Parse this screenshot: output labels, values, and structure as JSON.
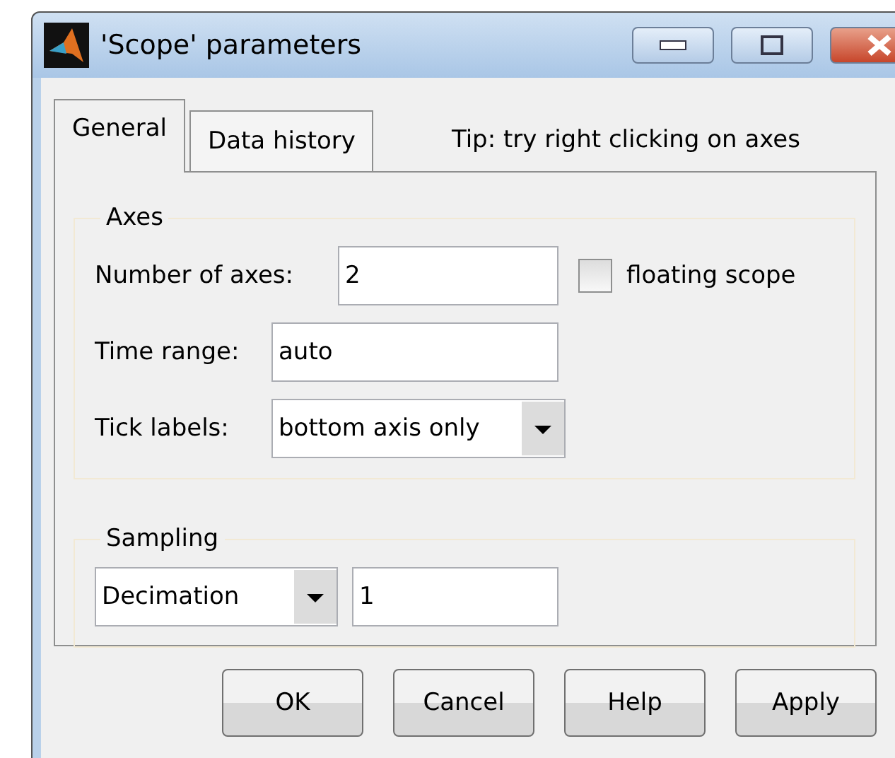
{
  "window": {
    "title": "'Scope' parameters"
  },
  "tabs": [
    {
      "label": "General",
      "selected": true
    },
    {
      "label": "Data history",
      "selected": false
    }
  ],
  "tip": "Tip: try right clicking on axes",
  "axes": {
    "legend": "Axes",
    "number_of_axes": {
      "label": "Number of axes:",
      "value": "2"
    },
    "floating_scope": {
      "label": "floating scope",
      "checked": false
    },
    "time_range": {
      "label": "Time range:",
      "value": "auto"
    },
    "tick_labels": {
      "label": "Tick labels:",
      "value": "bottom axis only"
    }
  },
  "sampling": {
    "legend": "Sampling",
    "mode": "Decimation",
    "value": "1"
  },
  "buttons": [
    "OK",
    "Cancel",
    "Help",
    "Apply"
  ]
}
